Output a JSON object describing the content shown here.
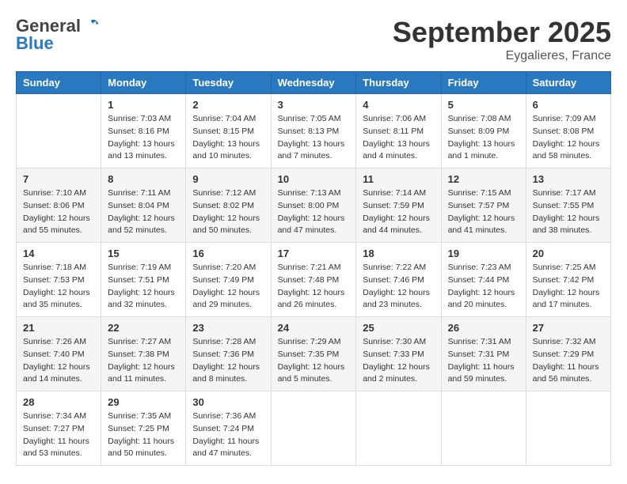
{
  "header": {
    "logo_general": "General",
    "logo_blue": "Blue",
    "month_title": "September 2025",
    "location": "Eygalieres, France"
  },
  "weekdays": [
    "Sunday",
    "Monday",
    "Tuesday",
    "Wednesday",
    "Thursday",
    "Friday",
    "Saturday"
  ],
  "weeks": [
    [
      {
        "day": "",
        "sunrise": "",
        "sunset": "",
        "daylight": ""
      },
      {
        "day": "1",
        "sunrise": "Sunrise: 7:03 AM",
        "sunset": "Sunset: 8:16 PM",
        "daylight": "Daylight: 13 hours and 13 minutes."
      },
      {
        "day": "2",
        "sunrise": "Sunrise: 7:04 AM",
        "sunset": "Sunset: 8:15 PM",
        "daylight": "Daylight: 13 hours and 10 minutes."
      },
      {
        "day": "3",
        "sunrise": "Sunrise: 7:05 AM",
        "sunset": "Sunset: 8:13 PM",
        "daylight": "Daylight: 13 hours and 7 minutes."
      },
      {
        "day": "4",
        "sunrise": "Sunrise: 7:06 AM",
        "sunset": "Sunset: 8:11 PM",
        "daylight": "Daylight: 13 hours and 4 minutes."
      },
      {
        "day": "5",
        "sunrise": "Sunrise: 7:08 AM",
        "sunset": "Sunset: 8:09 PM",
        "daylight": "Daylight: 13 hours and 1 minute."
      },
      {
        "day": "6",
        "sunrise": "Sunrise: 7:09 AM",
        "sunset": "Sunset: 8:08 PM",
        "daylight": "Daylight: 12 hours and 58 minutes."
      }
    ],
    [
      {
        "day": "7",
        "sunrise": "Sunrise: 7:10 AM",
        "sunset": "Sunset: 8:06 PM",
        "daylight": "Daylight: 12 hours and 55 minutes."
      },
      {
        "day": "8",
        "sunrise": "Sunrise: 7:11 AM",
        "sunset": "Sunset: 8:04 PM",
        "daylight": "Daylight: 12 hours and 52 minutes."
      },
      {
        "day": "9",
        "sunrise": "Sunrise: 7:12 AM",
        "sunset": "Sunset: 8:02 PM",
        "daylight": "Daylight: 12 hours and 50 minutes."
      },
      {
        "day": "10",
        "sunrise": "Sunrise: 7:13 AM",
        "sunset": "Sunset: 8:00 PM",
        "daylight": "Daylight: 12 hours and 47 minutes."
      },
      {
        "day": "11",
        "sunrise": "Sunrise: 7:14 AM",
        "sunset": "Sunset: 7:59 PM",
        "daylight": "Daylight: 12 hours and 44 minutes."
      },
      {
        "day": "12",
        "sunrise": "Sunrise: 7:15 AM",
        "sunset": "Sunset: 7:57 PM",
        "daylight": "Daylight: 12 hours and 41 minutes."
      },
      {
        "day": "13",
        "sunrise": "Sunrise: 7:17 AM",
        "sunset": "Sunset: 7:55 PM",
        "daylight": "Daylight: 12 hours and 38 minutes."
      }
    ],
    [
      {
        "day": "14",
        "sunrise": "Sunrise: 7:18 AM",
        "sunset": "Sunset: 7:53 PM",
        "daylight": "Daylight: 12 hours and 35 minutes."
      },
      {
        "day": "15",
        "sunrise": "Sunrise: 7:19 AM",
        "sunset": "Sunset: 7:51 PM",
        "daylight": "Daylight: 12 hours and 32 minutes."
      },
      {
        "day": "16",
        "sunrise": "Sunrise: 7:20 AM",
        "sunset": "Sunset: 7:49 PM",
        "daylight": "Daylight: 12 hours and 29 minutes."
      },
      {
        "day": "17",
        "sunrise": "Sunrise: 7:21 AM",
        "sunset": "Sunset: 7:48 PM",
        "daylight": "Daylight: 12 hours and 26 minutes."
      },
      {
        "day": "18",
        "sunrise": "Sunrise: 7:22 AM",
        "sunset": "Sunset: 7:46 PM",
        "daylight": "Daylight: 12 hours and 23 minutes."
      },
      {
        "day": "19",
        "sunrise": "Sunrise: 7:23 AM",
        "sunset": "Sunset: 7:44 PM",
        "daylight": "Daylight: 12 hours and 20 minutes."
      },
      {
        "day": "20",
        "sunrise": "Sunrise: 7:25 AM",
        "sunset": "Sunset: 7:42 PM",
        "daylight": "Daylight: 12 hours and 17 minutes."
      }
    ],
    [
      {
        "day": "21",
        "sunrise": "Sunrise: 7:26 AM",
        "sunset": "Sunset: 7:40 PM",
        "daylight": "Daylight: 12 hours and 14 minutes."
      },
      {
        "day": "22",
        "sunrise": "Sunrise: 7:27 AM",
        "sunset": "Sunset: 7:38 PM",
        "daylight": "Daylight: 12 hours and 11 minutes."
      },
      {
        "day": "23",
        "sunrise": "Sunrise: 7:28 AM",
        "sunset": "Sunset: 7:36 PM",
        "daylight": "Daylight: 12 hours and 8 minutes."
      },
      {
        "day": "24",
        "sunrise": "Sunrise: 7:29 AM",
        "sunset": "Sunset: 7:35 PM",
        "daylight": "Daylight: 12 hours and 5 minutes."
      },
      {
        "day": "25",
        "sunrise": "Sunrise: 7:30 AM",
        "sunset": "Sunset: 7:33 PM",
        "daylight": "Daylight: 12 hours and 2 minutes."
      },
      {
        "day": "26",
        "sunrise": "Sunrise: 7:31 AM",
        "sunset": "Sunset: 7:31 PM",
        "daylight": "Daylight: 11 hours and 59 minutes."
      },
      {
        "day": "27",
        "sunrise": "Sunrise: 7:32 AM",
        "sunset": "Sunset: 7:29 PM",
        "daylight": "Daylight: 11 hours and 56 minutes."
      }
    ],
    [
      {
        "day": "28",
        "sunrise": "Sunrise: 7:34 AM",
        "sunset": "Sunset: 7:27 PM",
        "daylight": "Daylight: 11 hours and 53 minutes."
      },
      {
        "day": "29",
        "sunrise": "Sunrise: 7:35 AM",
        "sunset": "Sunset: 7:25 PM",
        "daylight": "Daylight: 11 hours and 50 minutes."
      },
      {
        "day": "30",
        "sunrise": "Sunrise: 7:36 AM",
        "sunset": "Sunset: 7:24 PM",
        "daylight": "Daylight: 11 hours and 47 minutes."
      },
      {
        "day": "",
        "sunrise": "",
        "sunset": "",
        "daylight": ""
      },
      {
        "day": "",
        "sunrise": "",
        "sunset": "",
        "daylight": ""
      },
      {
        "day": "",
        "sunrise": "",
        "sunset": "",
        "daylight": ""
      },
      {
        "day": "",
        "sunrise": "",
        "sunset": "",
        "daylight": ""
      }
    ]
  ]
}
